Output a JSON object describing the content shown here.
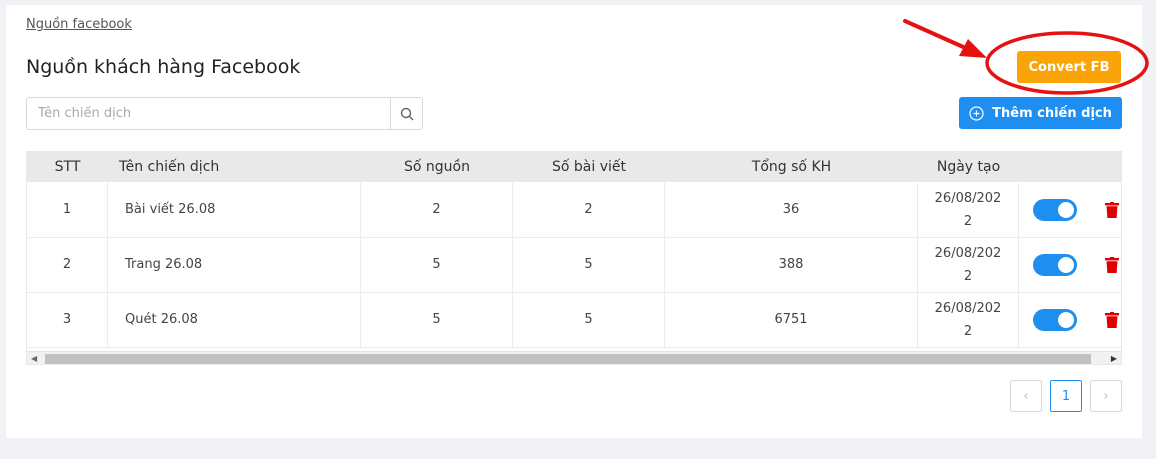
{
  "breadcrumb": "Nguồn facebook",
  "title": "Nguồn khách hàng Facebook",
  "convert_button": "Convert FB",
  "search": {
    "placeholder": "Tên chiến dịch"
  },
  "add_button": "Thêm chiến dịch",
  "table": {
    "columns": [
      "STT",
      "Tên chiến dịch",
      "Số nguồn",
      "Số bài viết",
      "Tổng số KH",
      "Ngày tạo",
      ""
    ],
    "rows": [
      {
        "stt": "1",
        "name": "Bài viết 26.08",
        "sources": "2",
        "posts": "2",
        "total": "36",
        "date": "26/08/2022",
        "active": true
      },
      {
        "stt": "2",
        "name": "Trang 26.08",
        "sources": "5",
        "posts": "5",
        "total": "388",
        "date": "26/08/2022",
        "active": true
      },
      {
        "stt": "3",
        "name": "Quét 26.08",
        "sources": "5",
        "posts": "5",
        "total": "6751",
        "date": "26/08/2022",
        "active": true
      }
    ]
  },
  "pagination": {
    "prev": "‹",
    "current": "1",
    "next": "›"
  },
  "icons": {
    "search": "search-icon",
    "add": "plus-circle-icon",
    "delete": "trash-icon",
    "scroll_left": "caret-left-icon",
    "scroll_right": "caret-right-icon"
  },
  "colors": {
    "convert": "#fba40a",
    "primary": "#1e8ff0",
    "delete": "#e00000",
    "annotation": "#e61212"
  }
}
